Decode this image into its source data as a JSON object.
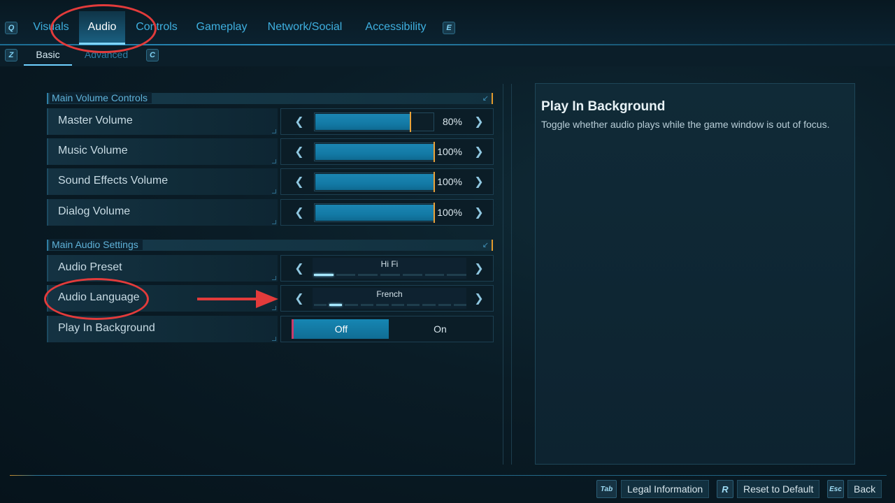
{
  "top_nav": {
    "prev_key": "Q",
    "next_key": "E",
    "tabs": [
      "Visuals",
      "Audio",
      "Controls",
      "Gameplay",
      "Network/Social",
      "Accessibility"
    ],
    "active_tab": "Audio"
  },
  "sub_nav": {
    "prev_key": "Z",
    "next_key": "C",
    "tabs": [
      "Basic",
      "Advanced"
    ],
    "active_tab": "Basic"
  },
  "sections": {
    "volume": {
      "title": "Main Volume Controls",
      "rows": [
        {
          "label": "Master Volume",
          "percent_text": "80%",
          "level": 0.8
        },
        {
          "label": "Music Volume",
          "percent_text": "100%",
          "level": 1.0
        },
        {
          "label": "Sound Effects Volume",
          "percent_text": "100%",
          "level": 1.0
        },
        {
          "label": "Dialog Volume",
          "percent_text": "100%",
          "level": 1.0
        }
      ]
    },
    "audio": {
      "title": "Main Audio Settings",
      "preset": {
        "label": "Audio Preset",
        "value": "Hi Fi",
        "option_index": 0,
        "option_count": 7
      },
      "language": {
        "label": "Audio Language",
        "value": "French",
        "option_index": 1,
        "option_count": 10
      },
      "background": {
        "label": "Play In Background",
        "off_label": "Off",
        "on_label": "On",
        "selected": "Off"
      }
    }
  },
  "info_panel": {
    "title": "Play In Background",
    "description": "Toggle whether audio plays while the game window is out of focus."
  },
  "footer": {
    "legal_key": "Tab",
    "legal_label": "Legal Information",
    "reset_key": "R",
    "reset_label": "Reset to Default",
    "back_key": "Esc",
    "back_label": "Back"
  },
  "colors": {
    "accent": "#3fb0e0",
    "slider_fill": "#137aa6",
    "annotation": "#e23b3b"
  }
}
